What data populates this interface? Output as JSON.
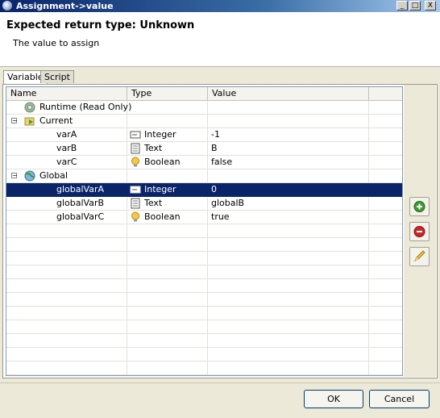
{
  "window": {
    "title": "Assignment->value",
    "controls": [
      "_",
      "□",
      "X"
    ]
  },
  "header": {
    "title": "Expected return type: Unknown",
    "subtitle": "The value to assign"
  },
  "tabs": [
    {
      "label": "Variable",
      "active": true
    },
    {
      "label": "Script",
      "active": false
    }
  ],
  "table": {
    "columns": [
      "Name",
      "Type",
      "Value"
    ],
    "rows": [
      {
        "name": "Runtime (Read Only)",
        "type": "",
        "value": "",
        "icon": "gear-globe-icon",
        "level": 1
      },
      {
        "name": "Current",
        "type": "",
        "value": "",
        "icon": "folder-arrow-icon",
        "level": 0,
        "expanded": true
      },
      {
        "name": "varA",
        "type": "Integer",
        "value": "-1",
        "type_icon": "integer-icon",
        "level": 2
      },
      {
        "name": "varB",
        "type": "Text",
        "value": "B",
        "type_icon": "text-icon",
        "level": 2
      },
      {
        "name": "varC",
        "type": "Boolean",
        "value": "false",
        "type_icon": "boolean-bulb-icon",
        "level": 2
      },
      {
        "name": "Global",
        "type": "",
        "value": "",
        "icon": "globe-icon",
        "level": 0,
        "expanded": true
      },
      {
        "name": "globalVarA",
        "type": "Integer",
        "value": "0",
        "type_icon": "integer-icon",
        "level": 2,
        "selected": true
      },
      {
        "name": "globalVarB",
        "type": "Text",
        "value": "globalB",
        "type_icon": "text-icon",
        "level": 2
      },
      {
        "name": "globalVarC",
        "type": "Boolean",
        "value": "true",
        "type_icon": "boolean-bulb-icon",
        "level": 2
      }
    ]
  },
  "side_buttons": [
    {
      "name": "add-variable-button",
      "icon": "add-icon"
    },
    {
      "name": "remove-variable-button",
      "icon": "remove-icon"
    },
    {
      "name": "edit-variable-button",
      "icon": "pencil-icon"
    }
  ],
  "footer": {
    "ok_label": "OK",
    "cancel_label": "Cancel"
  },
  "colors": {
    "selection": "#0a246a",
    "title_bar": "#0a246a",
    "add": "#3c9a2f",
    "remove": "#c8282a"
  }
}
